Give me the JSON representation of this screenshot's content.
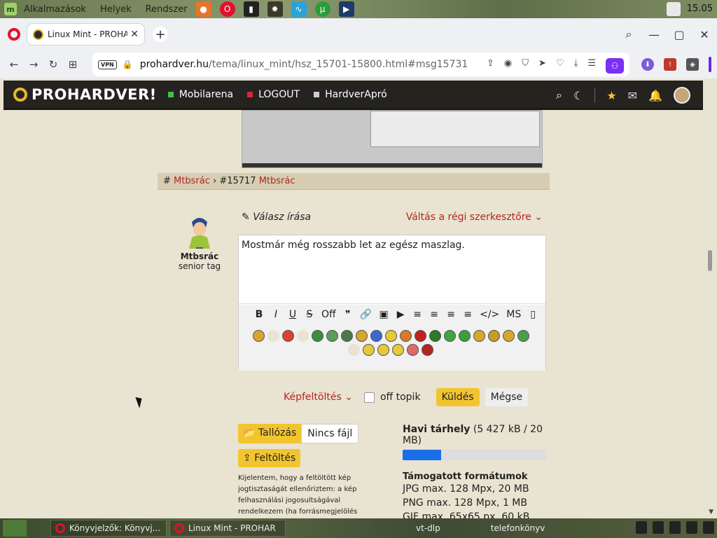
{
  "desktop": {
    "menu_apps": "Alkalmazások",
    "menu_places": "Helyek",
    "menu_system": "Rendszer",
    "clock": "15.05"
  },
  "browser": {
    "tab_title": "Linux Mint - PROHARDV",
    "url_host": "prohardver.hu",
    "url_path": "/tema/linux_mint/hsz_15701-15800.html#msg15731",
    "vpn_label": "VPN"
  },
  "site": {
    "logo": "PROHARDVER!",
    "nav": [
      {
        "label": "Mobilarena",
        "color": "#3ac34a"
      },
      {
        "label": "LOGOUT",
        "color": "#e0223a"
      },
      {
        "label": "HardverApró",
        "color": "#cccccc"
      }
    ]
  },
  "post": {
    "hash": "#",
    "author_link": "Mtbsrác",
    "post_id": "#15717",
    "author_link_2": "Mtbsrác"
  },
  "user": {
    "name": "Mtbsrác",
    "rank": "senior tag"
  },
  "reply": {
    "title": "Válasz írása",
    "switch_editor": "Váltás a régi szerkesztőre",
    "body": "Mostmár még rosszabb let az egész maszlag."
  },
  "toolbar": [
    "B",
    "I",
    "U",
    "S",
    "Off",
    "❞",
    "🔗",
    "▣",
    "▶",
    "≡",
    "≡",
    "≡",
    "≡",
    "</>",
    "MS",
    "▯"
  ],
  "smileys": [
    "#d8a62c",
    "#e9e3d1",
    "#e04030",
    "#e9e3d1",
    "#3b8f3b",
    "#5a9c5a",
    "#4a7a4a",
    "#d8a62c",
    "#3a6acb",
    "#e6c83a",
    "#d87a2a",
    "#c22020",
    "#2a7a2a",
    "#3ea63e",
    "#3aa03a",
    "#d8a62c",
    "#c89a2a",
    "#d8a62c",
    "#4aa04a",
    "#e9e3d1",
    "#e6c83a",
    "#e6c83a",
    "#e6c83a",
    "#e06a6a",
    "#b3261e"
  ],
  "actions": {
    "image_upload": "Képfeltöltés",
    "off_topic": "off topik",
    "send": "Küldés",
    "cancel": "Mégse"
  },
  "file": {
    "browse": "Tallózás",
    "no_file": "Nincs fájl",
    "upload": "Feltöltés",
    "legal": "Kijelentem, hogy a feltöltött kép jogtisztaságát ellenőriztem: a kép felhasználási jogosultságával rendelkezem (ha forrásmegjelölés szükséges, azt"
  },
  "quota": {
    "label": "Havi tárhely",
    "usage": "(5 427 kB / 20 MB)",
    "fraction": 0.27,
    "formats_title": "Támogatott formátumok",
    "formats": [
      "JPG max. 128 Mpx, 20 MB",
      "PNG max. 128 Mpx, 1 MB",
      "GIF max. 65x65 px, 60 kB"
    ]
  },
  "taskbar": {
    "win1": "Könyvjelzők: Könyvj...",
    "win2": "Linux Mint - PROHAR",
    "app3": "vt-dlp",
    "app4": "telefonkönyv"
  }
}
